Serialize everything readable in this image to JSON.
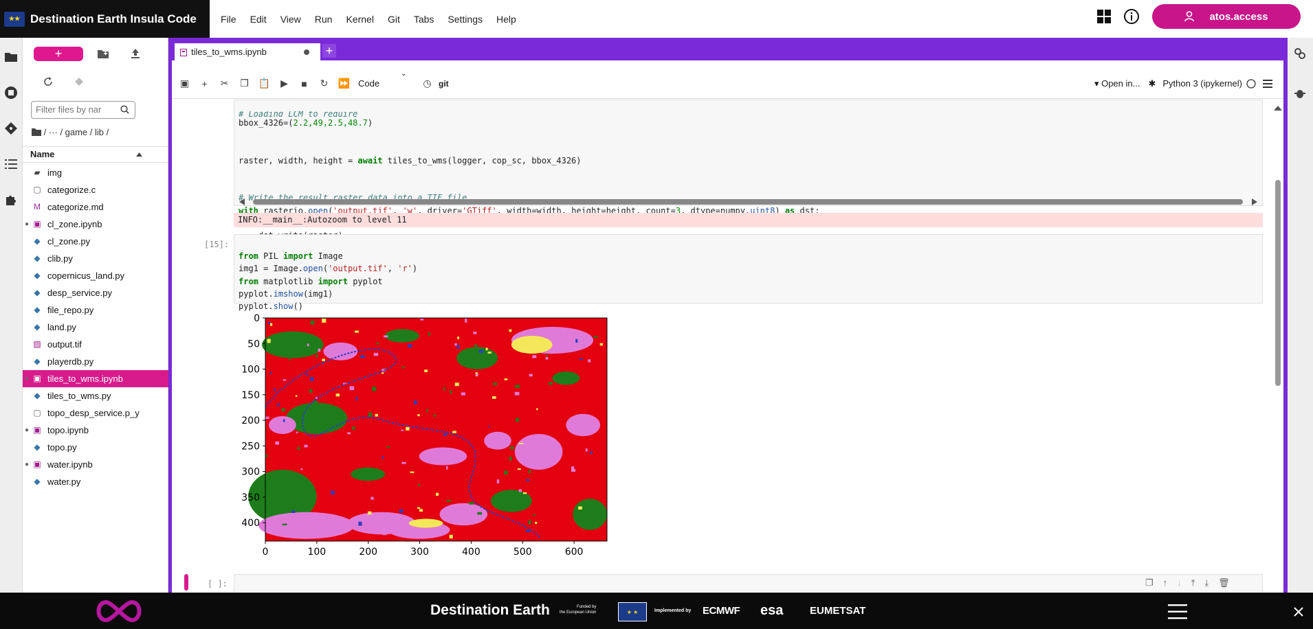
{
  "app": {
    "title": "Destination Earth Insula Code"
  },
  "menu": [
    "File",
    "Edit",
    "View",
    "Run",
    "Kernel",
    "Git",
    "Tabs",
    "Settings",
    "Help"
  ],
  "user": {
    "name": "atos.access"
  },
  "filebrowser": {
    "filter_placeholder": "Filter files by nar",
    "breadcrumb": "/ ··· / game / lib /",
    "col_name": "Name",
    "files": [
      {
        "name": "img",
        "type": "folder",
        "running": false,
        "selected": false
      },
      {
        "name": "categorize.c",
        "type": "file",
        "running": false,
        "selected": false
      },
      {
        "name": "categorize.md",
        "type": "markdown",
        "running": false,
        "selected": false
      },
      {
        "name": "cl_zone.ipynb",
        "type": "notebook",
        "running": true,
        "selected": false
      },
      {
        "name": "cl_zone.py",
        "type": "python",
        "running": false,
        "selected": false
      },
      {
        "name": "clib.py",
        "type": "python",
        "running": false,
        "selected": false
      },
      {
        "name": "copernicus_land.py",
        "type": "python",
        "running": false,
        "selected": false
      },
      {
        "name": "desp_service.py",
        "type": "python",
        "running": false,
        "selected": false
      },
      {
        "name": "file_repo.py",
        "type": "python",
        "running": false,
        "selected": false
      },
      {
        "name": "land.py",
        "type": "python",
        "running": false,
        "selected": false
      },
      {
        "name": "output.tif",
        "type": "image",
        "running": false,
        "selected": false
      },
      {
        "name": "playerdb.py",
        "type": "python",
        "running": false,
        "selected": false
      },
      {
        "name": "tiles_to_wms.ipynb",
        "type": "notebook",
        "running": true,
        "selected": true
      },
      {
        "name": "tiles_to_wms.py",
        "type": "python",
        "running": false,
        "selected": false
      },
      {
        "name": "topo_desp_service.p_y",
        "type": "file",
        "running": false,
        "selected": false
      },
      {
        "name": "topo.ipynb",
        "type": "notebook",
        "running": true,
        "selected": false
      },
      {
        "name": "topo.py",
        "type": "python",
        "running": false,
        "selected": false
      },
      {
        "name": "water.ipynb",
        "type": "notebook",
        "running": true,
        "selected": false
      },
      {
        "name": "water.py",
        "type": "python",
        "running": false,
        "selected": false
      }
    ]
  },
  "notebook": {
    "tab": "tiles_to_wms.ipynb",
    "celltype": "Code",
    "git": "git",
    "open_in": "Open in...",
    "kernel": "Python 3 (ipykernel)",
    "cell1": {
      "partial": "# Loading LCM to require",
      "line1_pre": "bbox_4326=(",
      "line1_vals": "2.2,49,2.5,48.7",
      "line1_post": ")",
      "line2": "raster, width, height = ",
      "line2_kw": "await",
      "line2_rest": " tiles_to_wms(logger, cop_sc, bbox_4326)",
      "comment": "# Write the result raster data into a TIF file",
      "line4_kw": "with",
      "line4_a": " rasterio.",
      "line4_fn": "open",
      "line4_b": "(",
      "line4_s1": "'output.tif'",
      "line4_c": ", ",
      "line4_s2": "'w'",
      "line4_d": ", driver=",
      "line4_s3": "'GTiff'",
      "line4_e": ", width=width, height=height, count=",
      "line4_n": "3",
      "line4_f": ", dtype=numpy.",
      "line4_fn2": "uint8",
      "line4_g": ") ",
      "line4_kw2": "as",
      "line4_h": " dst:",
      "line5": "    dst.write(raster)"
    },
    "info_output": "INFO:__main__:Autozoom to level 11",
    "cell2": {
      "prompt": "[15]:",
      "l1a": "from",
      "l1b": " PIL ",
      "l1c": "import",
      "l1d": " Image",
      "l2a": "img1 = Image.",
      "l2fn": "open",
      "l2b": "(",
      "l2s1": "'output.tif'",
      "l2c": ", ",
      "l2s2": "'r'",
      "l2d": ")",
      "l3a": "from",
      "l3b": " matplotlib ",
      "l3c": "import",
      "l3d": " pyplot",
      "l4a": "pyplot.",
      "l4fn": "imshow",
      "l4b": "(img1)",
      "l5a": "pyplot.",
      "l5fn": "show",
      "l5b": "()"
    },
    "empty_prompt": "[ ]:"
  },
  "plot": {
    "yticks": [
      "0",
      "50",
      "100",
      "150",
      "200",
      "250",
      "300",
      "350",
      "400"
    ],
    "xticks": [
      "0",
      "100",
      "200",
      "300",
      "400",
      "500",
      "600"
    ],
    "colors": {
      "bg": "#e3000f",
      "green": "#1e7d1a",
      "pink": "#e07ad8",
      "blue": "#2b3fbf",
      "yellow": "#f4e85a"
    }
  },
  "footer": {
    "title": "Destination Earth",
    "funded": "Funded by\nthe European Union",
    "implemented": "Implemented by",
    "ecmwf": "ECMWF",
    "esa": "esa",
    "eumetsat": "EUMETSAT"
  }
}
